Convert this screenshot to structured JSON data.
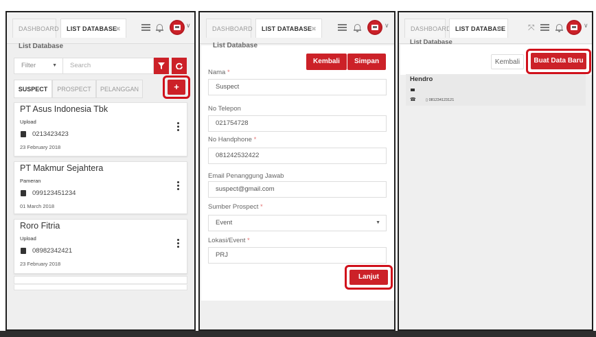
{
  "tabs": {
    "dashboard": "DASHBOARD",
    "list_database": "LIST DATABASE",
    "close": "✖"
  },
  "section_title": "List Database",
  "panel1": {
    "filter_label": "Filter",
    "search_placeholder": "Search",
    "segments": [
      "SUSPECT",
      "PROSPECT",
      "PELANGGAN"
    ],
    "add_label": "+",
    "cards": [
      {
        "name": "PT Asus Indonesia Tbk",
        "source": "Upload",
        "phone": "0213423423",
        "date": "23 February 2018"
      },
      {
        "name": "PT Makmur Sejahtera",
        "source": "Pameran",
        "phone": "099123451234",
        "date": "01 March 2018"
      },
      {
        "name": "Roro Fitria",
        "source": "Upload",
        "phone": "08982342421",
        "date": "23 February 2018"
      }
    ]
  },
  "panel2": {
    "back_label": "Kembali",
    "save_label": "Simpan",
    "next_label": "Lanjut",
    "fields": [
      {
        "label": "Nama",
        "required": true,
        "value": "Suspect"
      },
      {
        "label": "No Telepon",
        "required": false,
        "value": "021754728"
      },
      {
        "label": "No Handphone",
        "required": true,
        "value": "081242532422"
      },
      {
        "label": "Email Penanggung Jawab",
        "required": false,
        "value": "suspect@gmail.com"
      },
      {
        "label": "Sumber Prospect",
        "required": true,
        "value": "Event"
      },
      {
        "label": "Lokasi/Event",
        "required": true,
        "value": "PRJ"
      }
    ],
    "required_mark": "*"
  },
  "panel3": {
    "back_label": "Kembali",
    "create_label": "Buat Data Baru",
    "record": {
      "name": "Hendro",
      "phone": "081234123121"
    }
  },
  "colors": {
    "primary_red": "#cc2128",
    "highlight": "#d0101b",
    "panel_bg": "#efefef"
  },
  "icons": [
    "hamburger-icon",
    "bell-icon",
    "avatar-icon",
    "chevron-down-icon",
    "filter-icon",
    "refresh-icon",
    "plus-icon",
    "phone-icon",
    "more-vertical-icon",
    "email-icon",
    "expand-icon"
  ]
}
